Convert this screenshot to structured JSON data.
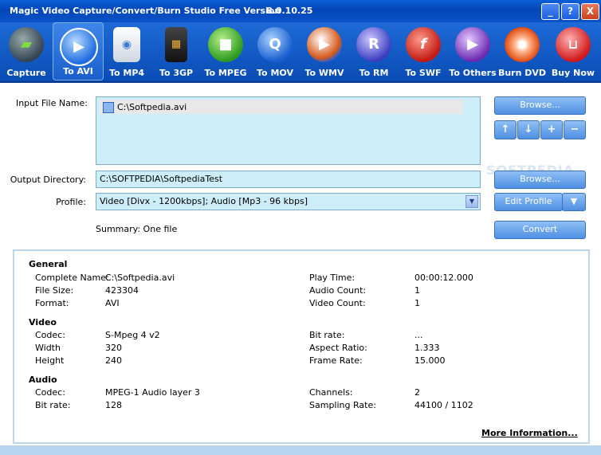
{
  "window": {
    "title": "Magic Video Capture/Convert/Burn Studio Free Version",
    "version": "8.0.10.25",
    "controls": [
      "_",
      "?",
      "X"
    ]
  },
  "toolbar": [
    {
      "label": "Capture",
      "icon": "camcorder-icon",
      "active": false
    },
    {
      "label": "To AVI",
      "icon": "play-icon",
      "active": true
    },
    {
      "label": "To MP4",
      "icon": "ipod-icon",
      "active": false
    },
    {
      "label": "To 3GP",
      "icon": "phone-icon",
      "active": false
    },
    {
      "label": "To MPEG",
      "icon": "video-camera-icon",
      "active": false
    },
    {
      "label": "To MOV",
      "icon": "quicktime-icon",
      "active": false
    },
    {
      "label": "To WMV",
      "icon": "media-player-icon",
      "active": false
    },
    {
      "label": "To RM",
      "icon": "realmedia-icon",
      "active": false
    },
    {
      "label": "To SWF",
      "icon": "flash-icon",
      "active": false
    },
    {
      "label": "To Others",
      "icon": "play-icon",
      "active": false
    },
    {
      "label": "Burn DVD",
      "icon": "disc-icon",
      "active": false
    },
    {
      "label": "Buy Now",
      "icon": "cart-icon",
      "active": false
    }
  ],
  "form": {
    "input_label": "Input File Name:",
    "input_file": "C:\\Softpedia.avi",
    "output_label": "Output Directory:",
    "output_dir": "C:\\SOFTPEDIA\\SoftpediaTest",
    "profile_label": "Profile:",
    "profile_value": "Video [Divx - 1200kbps]; Audio [Mp3 - 96 kbps]",
    "summary": "Summary: One file"
  },
  "buttons": {
    "browse_input": "Browse...",
    "browse_output": "Browse...",
    "edit_profile": "Edit Profile",
    "convert": "Convert",
    "up": "↑",
    "down": "↓",
    "add": "+",
    "remove": "−"
  },
  "watermark": "SOFTPEDIA",
  "info": {
    "general_title": "General",
    "video_title": "Video",
    "audio_title": "Audio",
    "general_left": [
      {
        "k": "Complete Name:",
        "v": "C:\\Softpedia.avi"
      },
      {
        "k": "File Size:",
        "v": "423304"
      },
      {
        "k": "Format:",
        "v": "AVI"
      }
    ],
    "general_right": [
      {
        "k": "Play Time:",
        "v": "00:00:12.000"
      },
      {
        "k": "Audio Count:",
        "v": "1"
      },
      {
        "k": "Video Count:",
        "v": "1"
      }
    ],
    "video_left": [
      {
        "k": "Codec:",
        "v": "S-Mpeg 4 v2"
      },
      {
        "k": "Width",
        "v": "320"
      },
      {
        "k": "Height",
        "v": "240"
      }
    ],
    "video_right": [
      {
        "k": "Bit rate:",
        "v": "..."
      },
      {
        "k": "Aspect Ratio:",
        "v": "1.333"
      },
      {
        "k": "Frame Rate:",
        "v": "15.000"
      }
    ],
    "audio_left": [
      {
        "k": "Codec:",
        "v": "MPEG-1 Audio layer 3"
      },
      {
        "k": "Bit rate:",
        "v": "128"
      }
    ],
    "audio_right": [
      {
        "k": "Channels:",
        "v": "2"
      },
      {
        "k": "Sampling Rate:",
        "v": "44100 / 1102"
      }
    ],
    "more": "More Information..."
  }
}
